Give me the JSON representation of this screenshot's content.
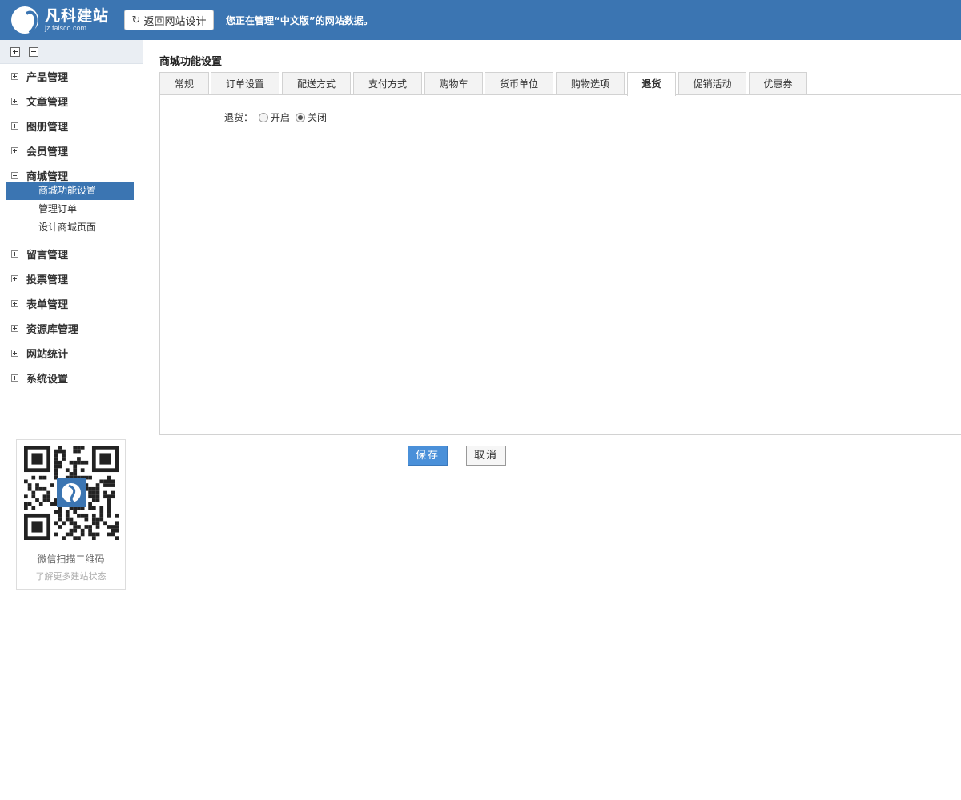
{
  "header": {
    "logo_name": "凡科建站",
    "logo_domain": "jz.faisco.com",
    "back_button": "返回网站设计",
    "manage_message": "您正在管理“中文版”的网站数据。",
    "brand_color": "#3b75b2"
  },
  "sidebar": {
    "tools": [
      "expand-all",
      "collapse-all"
    ],
    "groups_before": [
      {
        "label": "产品管理",
        "state": "collapsed"
      },
      {
        "label": "文章管理",
        "state": "collapsed"
      },
      {
        "label": "图册管理",
        "state": "collapsed"
      },
      {
        "label": "会员管理",
        "state": "collapsed"
      }
    ],
    "open_group": {
      "label": "商城管理",
      "state": "expanded",
      "items": [
        "商城功能设置",
        "管理订单",
        "设计商城页面"
      ],
      "active_index": 0
    },
    "groups_after": [
      {
        "label": "留言管理",
        "state": "collapsed"
      },
      {
        "label": "投票管理",
        "state": "collapsed"
      },
      {
        "label": "表单管理",
        "state": "collapsed"
      },
      {
        "label": "资源库管理",
        "state": "collapsed"
      },
      {
        "label": "网站统计",
        "state": "collapsed"
      },
      {
        "label": "系统设置",
        "state": "collapsed"
      }
    ],
    "qr": {
      "caption": "微信扫描二维码",
      "sub_caption": "了解更多建站状态"
    }
  },
  "main": {
    "title": "商城功能设置",
    "tabs": [
      {
        "label": "常规"
      },
      {
        "label": "订单设置"
      },
      {
        "label": "配送方式"
      },
      {
        "label": "支付方式"
      },
      {
        "label": "购物车"
      },
      {
        "label": "货币单位"
      },
      {
        "label": "购物选项"
      },
      {
        "label": "退货",
        "active": true
      },
      {
        "label": "促销活动"
      },
      {
        "label": "优惠券"
      }
    ],
    "return_setting": {
      "label": "退货：",
      "options": [
        {
          "label": "开启",
          "checked": false
        },
        {
          "label": "关闭",
          "checked": true
        }
      ]
    },
    "save_label": "保存",
    "cancel_label": "取消"
  }
}
